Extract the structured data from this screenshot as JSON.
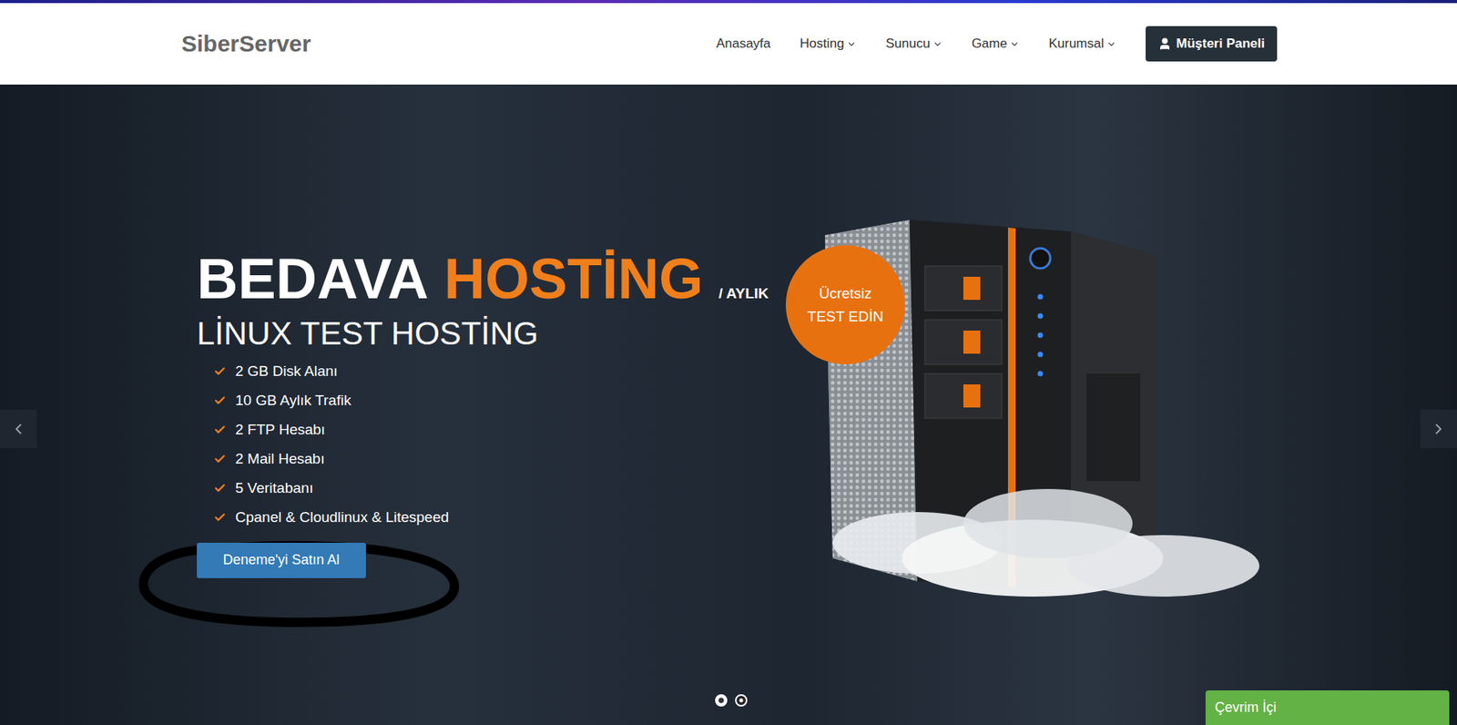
{
  "header": {
    "logo": "SiberServer",
    "nav": [
      {
        "label": "Anasayfa",
        "has_menu": false
      },
      {
        "label": "Hosting",
        "has_menu": true
      },
      {
        "label": "Sunucu",
        "has_menu": true
      },
      {
        "label": "Game",
        "has_menu": true
      },
      {
        "label": "Kurumsal",
        "has_menu": true
      }
    ],
    "panel_button": "Müşteri Paneli"
  },
  "hero": {
    "title_white": "BEDAVA",
    "title_orange": "HOSTİNG",
    "period": "/ AYLIK",
    "subtitle": "LİNUX TEST HOSTİNG",
    "features": [
      "2 GB Disk Alanı",
      "10 GB Aylık Trafik",
      "2 FTP Hesabı",
      "2 Mail Hesabı",
      "5 Veritabanı",
      "Cpanel & Cloudlinux & Litespeed"
    ],
    "button": "Deneme'yi Satın Al",
    "badge": {
      "lines": [
        "Ücretsiz",
        "TEST EDİN"
      ]
    }
  },
  "slides": [
    {
      "selected": true
    },
    {
      "selected": false
    }
  ],
  "chat": {
    "label": "Çevrim İçi"
  }
}
